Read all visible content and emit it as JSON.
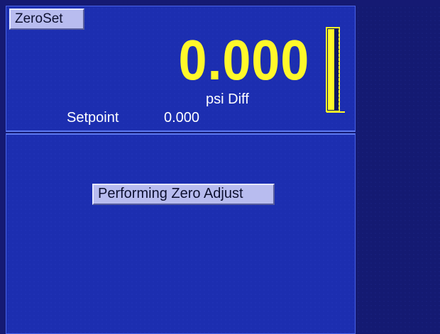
{
  "colors": {
    "panel_bg": "#1c2eb0",
    "side_bg": "#141a72",
    "reading_color": "#fff82a",
    "label_color": "#ffffff",
    "button_bg": "#b8bcef"
  },
  "header": {
    "mode_label": "ZeroSet"
  },
  "display": {
    "reading": "0.000",
    "units": "psi Diff",
    "setpoint_label": "Setpoint",
    "setpoint_value": "0.000",
    "bar_level": 0
  },
  "status": {
    "message": "Performing Zero Adjust"
  }
}
